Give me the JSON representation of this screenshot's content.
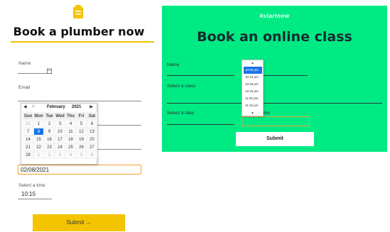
{
  "left": {
    "title": "Book a plumber now",
    "name_label": "Name",
    "email_label": "Email",
    "date_value": "02/08/2021",
    "time_label": "Select a time",
    "time_value": "10:15",
    "submit_label": "Submit →",
    "accent_color": "#f4c400",
    "calendar": {
      "prev": "◀",
      "home": "⌂",
      "next": "▶",
      "month": "February",
      "year": "2021",
      "weekdays": [
        "Sun",
        "Mon",
        "Tue",
        "Wed",
        "Thu",
        "Fri",
        "Sat"
      ],
      "days": [
        "31",
        "1",
        "2",
        "3",
        "4",
        "5",
        "6",
        "7",
        "8",
        "9",
        "10",
        "11",
        "12",
        "13",
        "14",
        "15",
        "16",
        "17",
        "18",
        "19",
        "20",
        "21",
        "22",
        "23",
        "24",
        "25",
        "26",
        "27",
        "28",
        "1",
        "2",
        "3",
        "4",
        "5",
        "6"
      ],
      "muted_indices": [
        0,
        29,
        30,
        31,
        32,
        33,
        34
      ],
      "selected_index": 8
    }
  },
  "right": {
    "brand": "#startnow",
    "title": "Book an online class",
    "name_label": "Name",
    "class_label": "Select a class",
    "date_label": "Select a date",
    "time_label_partial": "me",
    "submit_label": "Submit",
    "bg_color": "#00ea84",
    "time_options": [
      "10:00 pm",
      "10:15 pm",
      "10:30 pm",
      "10:45 pm",
      "11:00 pm",
      "11:15 pm"
    ],
    "selected_time_index": 0,
    "scroll_up": "▲",
    "scroll_down": "▼"
  }
}
